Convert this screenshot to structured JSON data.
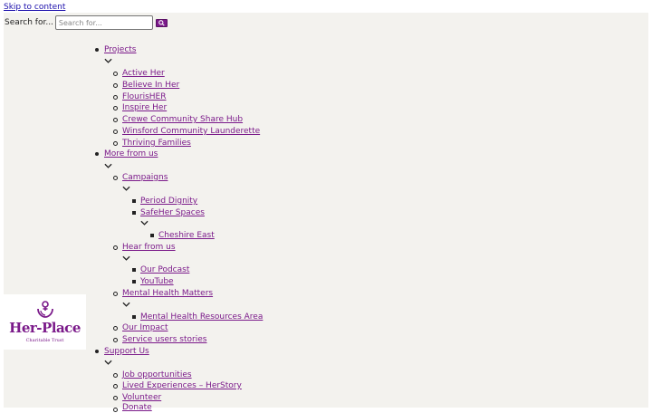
{
  "skip_link": "Skip to content",
  "search": {
    "label": "Search for...",
    "placeholder": "Search for...",
    "button_icon": "search-icon"
  },
  "brand": {
    "name": "Her-Place",
    "tagline": "Charitable Trust",
    "color": "#7b1a8a"
  },
  "nav": {
    "projects": {
      "label": "Projects",
      "items": [
        "Active Her",
        "Believe In Her",
        "FlourisHER",
        "Inspire Her",
        "Crewe Community Share Hub",
        "Winsford Community Launderette",
        "Thriving Families"
      ]
    },
    "more_from_us": {
      "label": "More from us",
      "campaigns": {
        "label": "Campaigns",
        "period_dignity": "Period Dignity",
        "safeher": {
          "label": "SafeHer Spaces",
          "cheshire_east": "Cheshire East"
        }
      },
      "hear_from_us": {
        "label": "Hear from us",
        "podcast": "Our Podcast",
        "youtube": "YouTube"
      },
      "mental_health": {
        "label": "Mental Health Matters",
        "resources": "Mental Health Resources Area"
      },
      "our_impact": "Our Impact",
      "service_users": "Service users stories"
    },
    "support_us": {
      "label": "Support Us",
      "items": [
        "Job opportunities",
        "Lived Experiences – HerStory",
        "Volunteer",
        "Donate"
      ]
    }
  }
}
